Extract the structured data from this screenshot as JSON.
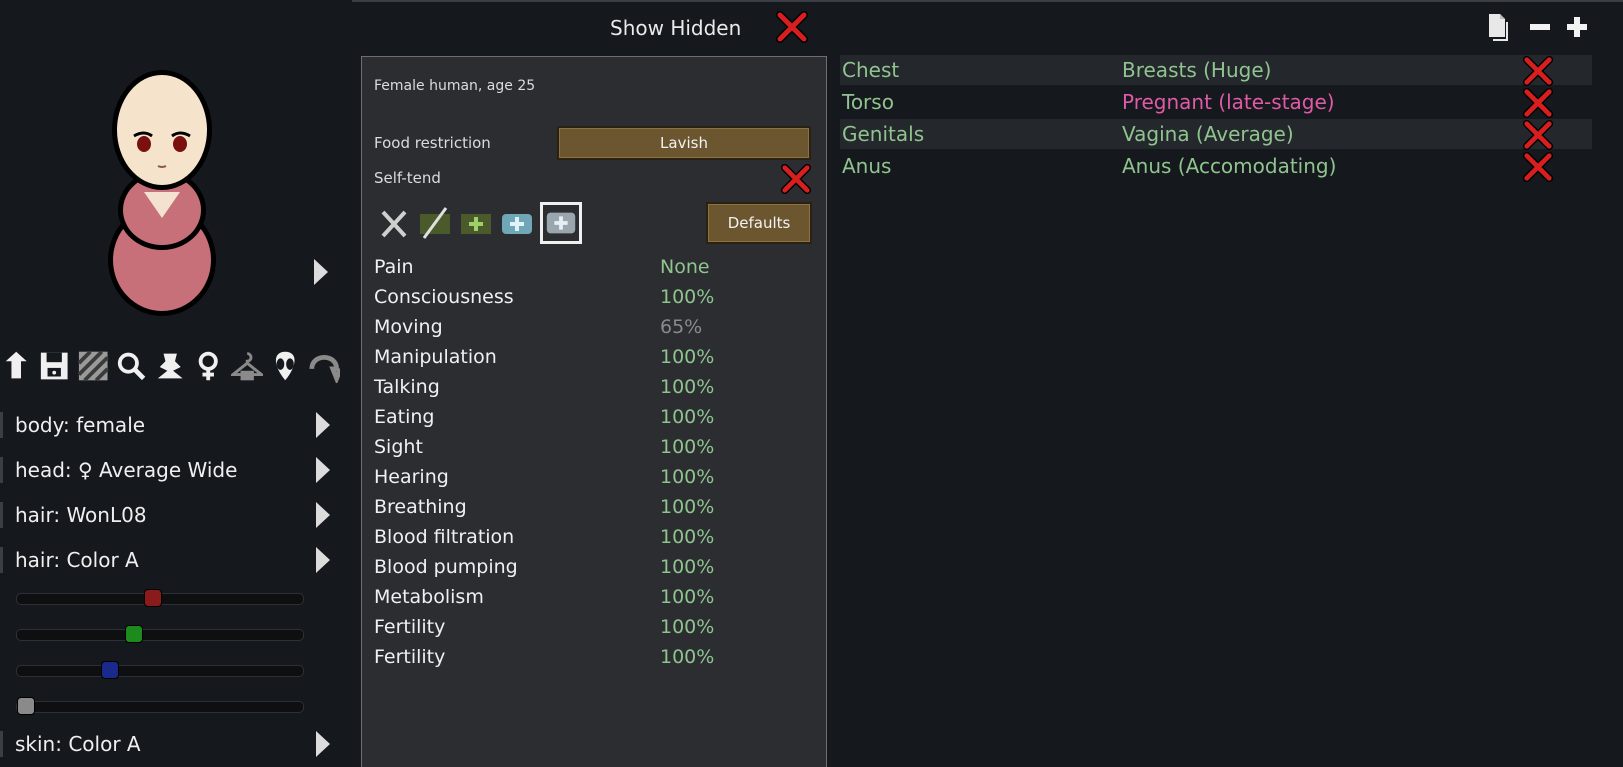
{
  "header": {
    "show_hidden_label": "Show Hidden"
  },
  "left": {
    "toolbar_icons": [
      "upload-icon",
      "save-icon",
      "stripes-icon",
      "search-icon",
      "bust-icon",
      "female-symbol-icon",
      "hanger-icon",
      "alien-icon",
      "loop-icon"
    ],
    "options": [
      {
        "label": "body: female"
      },
      {
        "label": "head: ♀ Average Wide"
      },
      {
        "label": "hair: WonL08"
      },
      {
        "label": "hair: Color A"
      }
    ],
    "sliders": [
      {
        "color": "#8b1a1a",
        "value": 0.47
      },
      {
        "color": "#1c8a1c",
        "value": 0.4
      },
      {
        "color": "#1a2a8b",
        "value": 0.31
      },
      {
        "color": "#8a8a8a",
        "value": 0.0
      }
    ],
    "skin_option": {
      "label": "skin: Color A"
    }
  },
  "middle": {
    "description": "Female human, age 25",
    "food_restriction_label": "Food restriction",
    "food_restriction_value": "Lavish",
    "self_tend_label": "Self-tend",
    "defaults_label": "Defaults",
    "care_icons": [
      "no-care-icon",
      "no-meds-icon",
      "herbal-meds-icon",
      "industrial-meds-icon",
      "glitterworld-meds-icon"
    ],
    "capacities": [
      {
        "name": "Pain",
        "value": "None",
        "color": "#8fc48f"
      },
      {
        "name": "Consciousness",
        "value": "100%",
        "color": "#8fc48f"
      },
      {
        "name": "Moving",
        "value": "65%",
        "color": "#8a8a8a"
      },
      {
        "name": "Manipulation",
        "value": "100%",
        "color": "#8fc48f"
      },
      {
        "name": "Talking",
        "value": "100%",
        "color": "#8fc48f"
      },
      {
        "name": "Eating",
        "value": "100%",
        "color": "#8fc48f"
      },
      {
        "name": "Sight",
        "value": "100%",
        "color": "#8fc48f"
      },
      {
        "name": "Hearing",
        "value": "100%",
        "color": "#8fc48f"
      },
      {
        "name": "Breathing",
        "value": "100%",
        "color": "#8fc48f"
      },
      {
        "name": "Blood filtration",
        "value": "100%",
        "color": "#8fc48f"
      },
      {
        "name": "Blood pumping",
        "value": "100%",
        "color": "#8fc48f"
      },
      {
        "name": "Metabolism",
        "value": "100%",
        "color": "#8fc48f"
      },
      {
        "name": "Fertility",
        "value": "100%",
        "color": "#8fc48f"
      },
      {
        "name": "Fertility",
        "value": "100%",
        "color": "#8fc48f"
      }
    ]
  },
  "right": {
    "top_icons": [
      "copy-icon",
      "minus-icon",
      "plus-icon"
    ],
    "parts": [
      {
        "part": "Chest",
        "condition": "Breasts (Huge)",
        "color": "#8fc48f"
      },
      {
        "part": "Torso",
        "condition": "Pregnant (late-stage)",
        "color": "#e05aa8"
      },
      {
        "part": "Genitals",
        "condition": "Vagina (Average)",
        "color": "#8fc48f"
      },
      {
        "part": "Anus",
        "condition": "Anus (Accomodating)",
        "color": "#8fc48f"
      }
    ]
  }
}
